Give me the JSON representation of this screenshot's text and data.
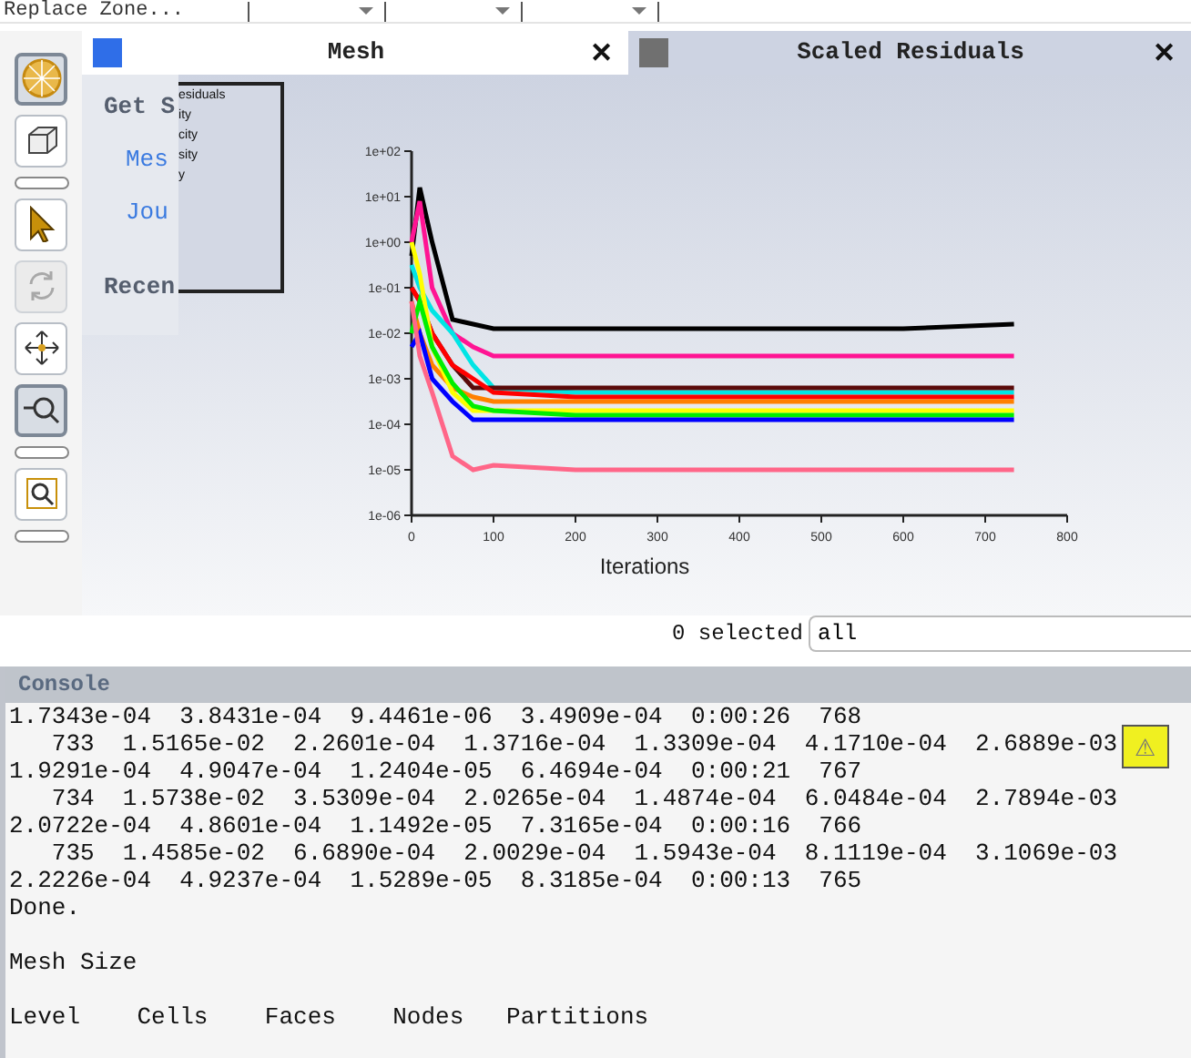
{
  "top_strip": {
    "label": "Replace Zone..."
  },
  "toolbar": [
    {
      "kind": "mesh-sphere",
      "selected": true,
      "disabled": false
    },
    {
      "kind": "cube",
      "selected": false,
      "disabled": false
    },
    {
      "kind": "collapse",
      "selected": false,
      "disabled": false
    },
    {
      "kind": "pointer",
      "selected": false,
      "disabled": false
    },
    {
      "kind": "rotate",
      "selected": false,
      "disabled": true
    },
    {
      "kind": "pan",
      "selected": false,
      "disabled": false
    },
    {
      "kind": "zoom-box",
      "selected": true,
      "disabled": false
    },
    {
      "kind": "collapse",
      "selected": false,
      "disabled": false
    },
    {
      "kind": "zoom-fit",
      "selected": false,
      "disabled": false
    },
    {
      "kind": "collapse",
      "selected": false,
      "disabled": false
    }
  ],
  "tabs": [
    {
      "title": "Mesh",
      "close": "✕",
      "selected": true
    },
    {
      "title": "Scaled Residuals",
      "close": "✕",
      "selected": false
    }
  ],
  "get_started": {
    "title": "Get S",
    "links": [
      "Mes",
      "Jou"
    ],
    "recent": "Recen"
  },
  "legend": [
    "esiduals",
    "ity",
    "city",
    "sity",
    "y"
  ],
  "chart": {
    "xlabel": "Iterations",
    "xticks": [
      "0",
      "100",
      "200",
      "300",
      "400",
      "500",
      "600",
      "700",
      "800"
    ],
    "yticks": [
      "1e+02",
      "1e+01",
      "1e+00",
      "1e-01",
      "1e-02",
      "1e-03",
      "1e-04",
      "1e-05",
      "1e-06"
    ]
  },
  "selection": {
    "count": "0 selected",
    "value": "all"
  },
  "console": {
    "title": "Console",
    "warning": "⚠",
    "blocks": [
      [
        "1.7343e-04  3.8431e-04  9.4461e-06  3.4909e-04  0:00:26  768",
        "   733  1.5165e-02  2.2601e-04  1.3716e-04  1.3309e-04  4.1710e-04  2.6889e-03",
        "1.9291e-04  4.9047e-04  1.2404e-05  6.4694e-04  0:00:21  767",
        "   734  1.5738e-02  3.5309e-04  2.0265e-04  1.4874e-04  6.0484e-04  2.7894e-03",
        "2.0722e-04  4.8601e-04  1.1492e-05  7.3165e-04  0:00:16  766",
        "   735  1.4585e-02  6.6890e-04  2.0029e-04  1.5943e-04  8.1119e-04  3.1069e-03",
        "2.2226e-04  4.9237e-04  1.5289e-05  8.3185e-04  0:00:13  765",
        "Done."
      ],
      [
        "Mesh Size"
      ],
      [
        "Level    Cells    Faces    Nodes   Partitions"
      ]
    ]
  }
}
